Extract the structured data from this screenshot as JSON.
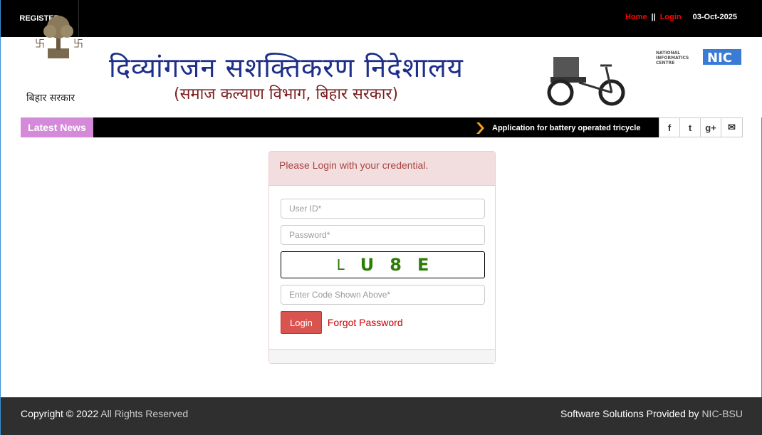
{
  "topbar": {
    "register": "REGISTER",
    "home": "Home",
    "sep": "||",
    "login": "Login",
    "date": "03-Oct-2025"
  },
  "header": {
    "emblem_caption": "बिहार सरकार",
    "title": "दिव्यांगजन सशक्तिकरण निदेशालय",
    "subtitle": "(समाज कल्याण विभाग, बिहार सरकार)",
    "nic_small": "NATIONAL INFORMATICS CENTRE",
    "nic_logo": "NIC"
  },
  "news": {
    "tag": "Latest News",
    "item": "Application for battery operated tricycle",
    "social": [
      "facebook-icon",
      "twitter-icon",
      "google-plus-icon",
      "mail-icon"
    ],
    "social_glyphs": [
      "f",
      "t",
      "g+",
      "✉"
    ]
  },
  "login_panel": {
    "heading": "Please Login with your credential.",
    "userid_placeholder": "User ID*",
    "password_placeholder": "Password*",
    "captcha_chars": [
      "L",
      "U",
      "8",
      "E"
    ],
    "code_placeholder": "Enter Code Shown Above*",
    "login_button": "Login",
    "forgot": "Forgot Password"
  },
  "footer": {
    "copyright": "Copyright © 2022",
    "rights": "All Rights Reserved",
    "provided": "Software Solutions Provided by",
    "provider": "NIC-BSU"
  },
  "colors": {
    "accent_red": "#ff0000",
    "title_blue": "#1d2f8a",
    "news_tag": "#d48ad9",
    "captcha_green": "#2e7d0b"
  }
}
